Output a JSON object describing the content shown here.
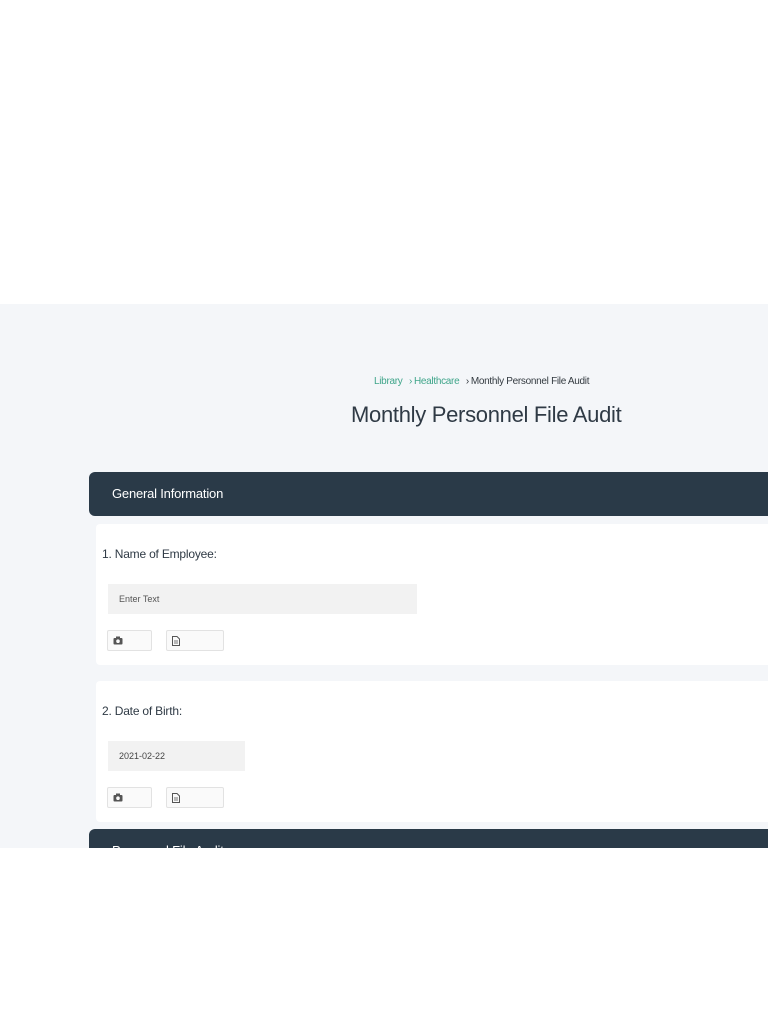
{
  "breadcrumb": {
    "items": [
      "Library",
      "Healthcare"
    ],
    "separator": "›",
    "current": "Monthly Personnel File Audit"
  },
  "page": {
    "title": "Monthly Personnel File Audit"
  },
  "sections": [
    {
      "title": "General Information",
      "questions": [
        {
          "label": "1. Name of Employee:",
          "input_type": "text",
          "value": "",
          "placeholder": "Enter Text",
          "attachments": [
            "camera-icon",
            "document-icon"
          ]
        },
        {
          "label": "2. Date of Birth:",
          "input_type": "date",
          "value": "2021-02-22",
          "placeholder": "",
          "attachments": [
            "camera-icon",
            "document-icon"
          ]
        }
      ]
    },
    {
      "title": "Personnel File Audit"
    }
  ],
  "colors": {
    "background": "#f4f6f9",
    "section_header": "#2a3a48",
    "link": "#3fa58a",
    "text": "#2f3a45",
    "input_bg": "#f2f2f2"
  }
}
